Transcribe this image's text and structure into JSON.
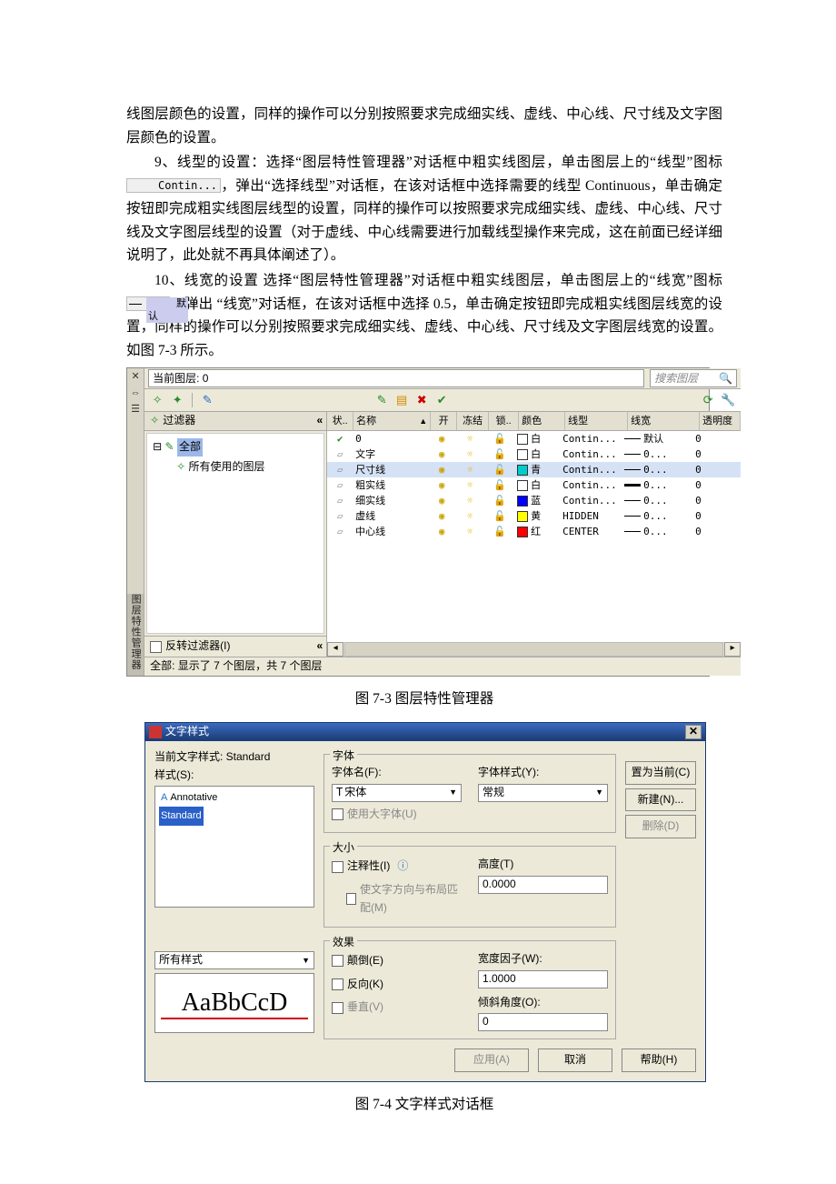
{
  "doc": {
    "p1": "线图层颜色的设置，同样的操作可以分别按照要求完成细实线、虚线、中心线、尺寸线及文字图层颜色的设置。",
    "p2a": "9、线型的设置：选择“图层特性管理器”对话框中粗实线图层，单击图层上的“线型”图标",
    "p2_icon": "Contin...",
    "p2b": "，弹出“选择线型”对话框，在该对话框中选择需要的线型 Continuous，单击确定按钮即完成粗实线图层线型的设置，同样的操作可以按照要求完成细实线、虚线、中心线、尺寸线及文字图层线型的设置（对于虚线、中心线需要进行加载线型操作来完成，这在前面已经详细说明了，此处就不再具体阐述了）。",
    "p3a": "10、线宽的设置 选择“图层特性管理器”对话框中粗实线图层，单击图层上的“线宽”图标",
    "p3_icon_text": "默认",
    "p3b": "，弹出 “线宽”对话框，在该对话框中选择 0.5，单击确定按钮即完成粗实线图层线宽的设置，同样的操作可以分别按照要求完成细实线、虚线、中心线、尺寸线及文字图层线宽的设置。如图 7-3 所示。",
    "caption1": "图 7-3 图层特性管理器",
    "caption2": "图 7-4 文字样式对话框"
  },
  "layer_mgr": {
    "vert_title": "图层特性管理器",
    "current_layer_label": "当前图层: 0",
    "search_placeholder": "搜索图层",
    "filter_title": "过滤器",
    "filter_root": "全部",
    "filter_child": "所有使用的图层",
    "invert_filter": "反转过滤器(I)",
    "status_text": "全部: 显示了 7 个图层，共 7 个图层",
    "columns": {
      "state": "状..",
      "name": "名称",
      "on": "开",
      "freeze": "冻结",
      "lock": "锁..",
      "color": "颜色",
      "ltype": "线型",
      "lweight": "线宽",
      "trans": "透明度"
    },
    "rows": [
      {
        "state": "✔",
        "name": "0",
        "color_hex": "#ffffff",
        "color_name": "白",
        "ltype": "Contin...",
        "lw_heavy": false,
        "lw_text": "默认",
        "trans": "0",
        "sel": false
      },
      {
        "state": "▱",
        "name": "文字",
        "color_hex": "#ffffff",
        "color_name": "白",
        "ltype": "Contin...",
        "lw_heavy": false,
        "lw_text": "0...",
        "trans": "0",
        "sel": false
      },
      {
        "state": "▱",
        "name": "尺寸线",
        "color_hex": "#00cccc",
        "color_name": "青",
        "ltype": "Contin...",
        "lw_heavy": false,
        "lw_text": "0...",
        "trans": "0",
        "sel": true
      },
      {
        "state": "▱",
        "name": "粗实线",
        "color_hex": "#ffffff",
        "color_name": "白",
        "ltype": "Contin...",
        "lw_heavy": true,
        "lw_text": "0...",
        "trans": "0",
        "sel": false
      },
      {
        "state": "▱",
        "name": "细实线",
        "color_hex": "#0000ff",
        "color_name": "蓝",
        "ltype": "Contin...",
        "lw_heavy": false,
        "lw_text": "0...",
        "trans": "0",
        "sel": false
      },
      {
        "state": "▱",
        "name": "虚线",
        "color_hex": "#ffff00",
        "color_name": "黄",
        "ltype": "HIDDEN",
        "lw_heavy": false,
        "lw_text": "0...",
        "trans": "0",
        "sel": false
      },
      {
        "state": "▱",
        "name": "中心线",
        "color_hex": "#ff0000",
        "color_name": "红",
        "ltype": "CENTER",
        "lw_heavy": false,
        "lw_text": "0...",
        "trans": "0",
        "sel": false
      }
    ]
  },
  "text_style": {
    "title": "文字样式",
    "current_style_label": "当前文字样式:  Standard",
    "styles_label": "样式(S):",
    "styles": [
      "Annotative",
      "Standard"
    ],
    "selected_style_index": 1,
    "style_filter": "所有样式",
    "preview_sample": "AaBbCcD",
    "font_group": "字体",
    "font_name_label": "字体名(F):",
    "font_name_value": "宋体",
    "font_style_label": "字体样式(Y):",
    "font_style_value": "常规",
    "use_bigfont": "使用大字体(U)",
    "size_group": "大小",
    "annotative": "注释性(I)",
    "match_orient": "使文字方向与布局匹配(M)",
    "height_label": "高度(T)",
    "height_value": "0.0000",
    "effects_group": "效果",
    "upside_down": "颠倒(E)",
    "backwards": "反向(K)",
    "vertical": "垂直(V)",
    "width_factor_label": "宽度因子(W):",
    "width_factor_value": "1.0000",
    "oblique_label": "倾斜角度(O):",
    "oblique_value": "0",
    "btn_set_current": "置为当前(C)",
    "btn_new": "新建(N)...",
    "btn_delete": "删除(D)",
    "btn_apply": "应用(A)",
    "btn_cancel": "取消",
    "btn_help": "帮助(H)"
  }
}
